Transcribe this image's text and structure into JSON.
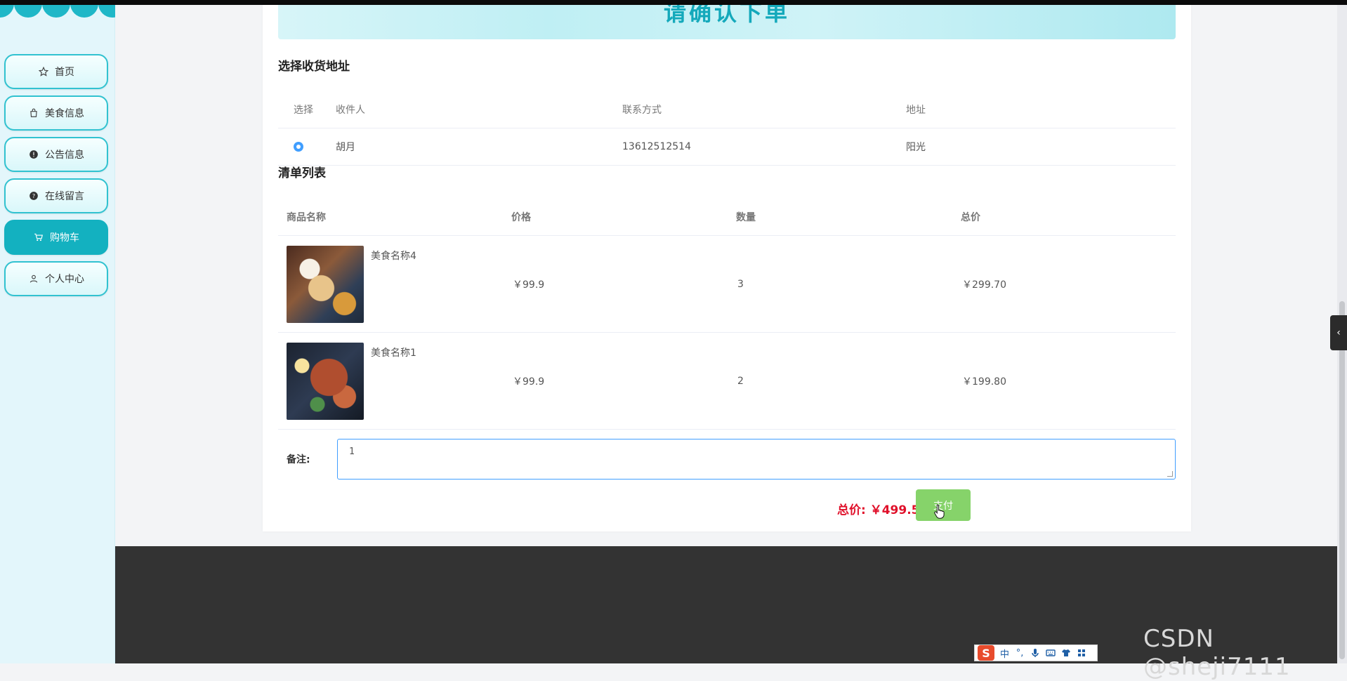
{
  "sidebar": {
    "items": [
      {
        "label": "首页",
        "icon": "star-icon",
        "active": false
      },
      {
        "label": "美食信息",
        "icon": "bag-icon",
        "active": false
      },
      {
        "label": "公告信息",
        "icon": "alert-icon",
        "active": false
      },
      {
        "label": "在线留言",
        "icon": "help-icon",
        "active": false
      },
      {
        "label": "购物车",
        "icon": "cart-icon",
        "active": true
      },
      {
        "label": "个人中心",
        "icon": "user-icon",
        "active": false
      }
    ]
  },
  "banner": {
    "title": "请确认下单"
  },
  "address": {
    "section_title": "选择收货地址",
    "headers": [
      "选择",
      "收件人",
      "联系方式",
      "地址"
    ],
    "rows": [
      {
        "recipient": "胡月",
        "phone": "13612512514",
        "address": "阳光",
        "selected": true
      }
    ]
  },
  "items": {
    "section_title": "清单列表",
    "headers": [
      "商品名称",
      "价格",
      "数量",
      "总价"
    ],
    "rows": [
      {
        "name": "美食名称4",
        "price": "￥99.9",
        "qty": "3",
        "total": "￥299.70",
        "image": "food-photo-4"
      },
      {
        "name": "美食名称1",
        "price": "￥99.9",
        "qty": "2",
        "total": "￥199.80",
        "image": "food-photo-1"
      }
    ]
  },
  "remark": {
    "label": "备注:",
    "value": "1"
  },
  "summary": {
    "total_text": "总价: ￥499.50",
    "pay_label": "支付"
  },
  "ime": {
    "mode": "中",
    "logo": "S"
  },
  "watermark": "CSDN @sheji7111",
  "colors": {
    "accent": "#13b1c0",
    "pay": "#86d36a",
    "total": "#e0102a",
    "footer": "#333333"
  }
}
